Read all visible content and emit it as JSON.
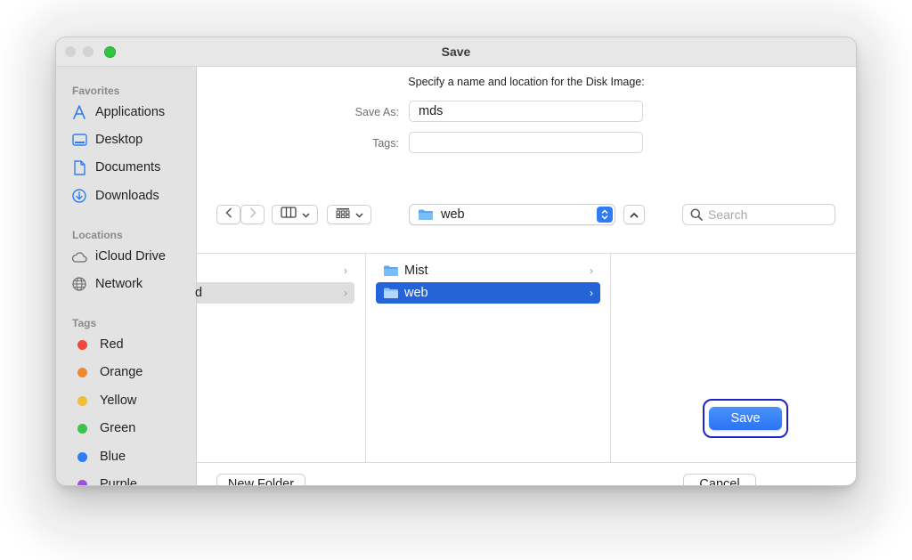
{
  "window": {
    "title": "Save"
  },
  "sidebar": {
    "favorites_heading": "Favorites",
    "favorites": [
      {
        "label": "Applications",
        "icon": "applications-icon"
      },
      {
        "label": "Desktop",
        "icon": "desktop-icon"
      },
      {
        "label": "Documents",
        "icon": "document-icon"
      },
      {
        "label": "Downloads",
        "icon": "downloads-icon"
      }
    ],
    "locations_heading": "Locations",
    "locations": [
      {
        "label": "iCloud Drive",
        "icon": "cloud-icon"
      },
      {
        "label": "Network",
        "icon": "globe-icon"
      }
    ],
    "tags_heading": "Tags",
    "tags": [
      {
        "label": "Red",
        "color": "#f0463c"
      },
      {
        "label": "Orange",
        "color": "#f08a2c"
      },
      {
        "label": "Yellow",
        "color": "#f3c02c"
      },
      {
        "label": "Green",
        "color": "#3fc24a"
      },
      {
        "label": "Blue",
        "color": "#2f7cf6"
      },
      {
        "label": "Purple",
        "color": "#a04ee0"
      }
    ]
  },
  "form": {
    "prompt": "Specify a name and location for the Disk Image:",
    "save_as_label": "Save As:",
    "save_as_value": "mds",
    "tags_label": "Tags:",
    "tags_value": ""
  },
  "toolbar": {
    "location": "web",
    "search_placeholder": "Search"
  },
  "browser": {
    "column1": [
      {
        "label": ""
      },
      {
        "label": "d"
      }
    ],
    "column2": [
      {
        "label": "Mist"
      },
      {
        "label": "web"
      }
    ]
  },
  "buttons": {
    "new_folder": "New Folder",
    "cancel": "Cancel",
    "save": "Save"
  },
  "colors": {
    "accent": "#2f7cf6",
    "selection": "#2563d9",
    "focus_ring": "#1d23c9"
  }
}
